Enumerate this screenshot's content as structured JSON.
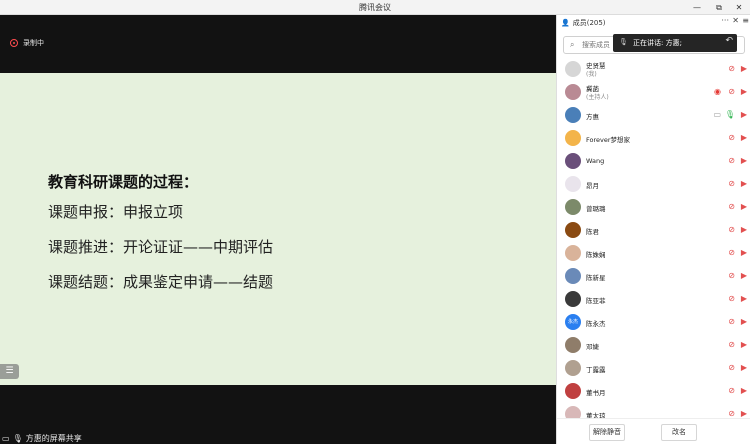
{
  "window": {
    "title": "腾讯会议",
    "controls": [
      "—",
      "⧉",
      "✕"
    ]
  },
  "meeting": {
    "recording_label": "录制中",
    "slide": {
      "heading": "教育科研课题的过程：",
      "lines": [
        "课题申报：申报立项",
        "课题推进：开论证证——中期评估",
        "课题结题：成果鉴定申请——结题"
      ]
    },
    "share_label": "方惠的屏幕共享"
  },
  "members": {
    "title": "成员(205)",
    "more_glyph": "···",
    "close_glyph": "✕",
    "collapse_glyph": "≡",
    "search_placeholder": "搜索成员",
    "speaking": "正在讲话: 方惠;",
    "items": [
      {
        "name": "史贤慧",
        "sub": "(我)",
        "avatar": "#d6d6d6"
      },
      {
        "name": "冀菡",
        "sub": "(主持人)",
        "avatar": "#b98a94",
        "recording": true
      },
      {
        "name": "方惠",
        "sub": "",
        "avatar": "#4a7fb8",
        "speaking": true
      },
      {
        "name": "Forever梦想家",
        "sub": "",
        "avatar": "#f3b44a"
      },
      {
        "name": "Wang",
        "sub": "",
        "avatar": "#6a4f7a"
      },
      {
        "name": "昂月",
        "sub": "",
        "avatar": "#e9e4ec"
      },
      {
        "name": "曾璐璐",
        "sub": "",
        "avatar": "#7c8a6a"
      },
      {
        "name": "陈君",
        "sub": "",
        "avatar": "#8a4a12"
      },
      {
        "name": "陈姝娴",
        "sub": "",
        "avatar": "#d9b39a"
      },
      {
        "name": "陈新星",
        "sub": "",
        "avatar": "#6a8ab8"
      },
      {
        "name": "陈亚菲",
        "sub": "",
        "avatar": "#3a3a3a"
      },
      {
        "name": "陈永杰",
        "sub": "",
        "avatar": "#2a7ff0",
        "initials": "永杰"
      },
      {
        "name": "邓婕",
        "sub": "",
        "avatar": "#8f7d6a"
      },
      {
        "name": "丁露露",
        "sub": "",
        "avatar": "#b0a090"
      },
      {
        "name": "董书月",
        "sub": "",
        "avatar": "#c04040"
      },
      {
        "name": "董太琼",
        "sub": "",
        "avatar": "#d8b8b8"
      }
    ],
    "buttons": {
      "mute_all": "解除静音",
      "rename": "改名"
    }
  },
  "colors": {
    "slide_bg": "#e6f1dd",
    "danger": "#e25050",
    "ok": "#2bb24c"
  }
}
